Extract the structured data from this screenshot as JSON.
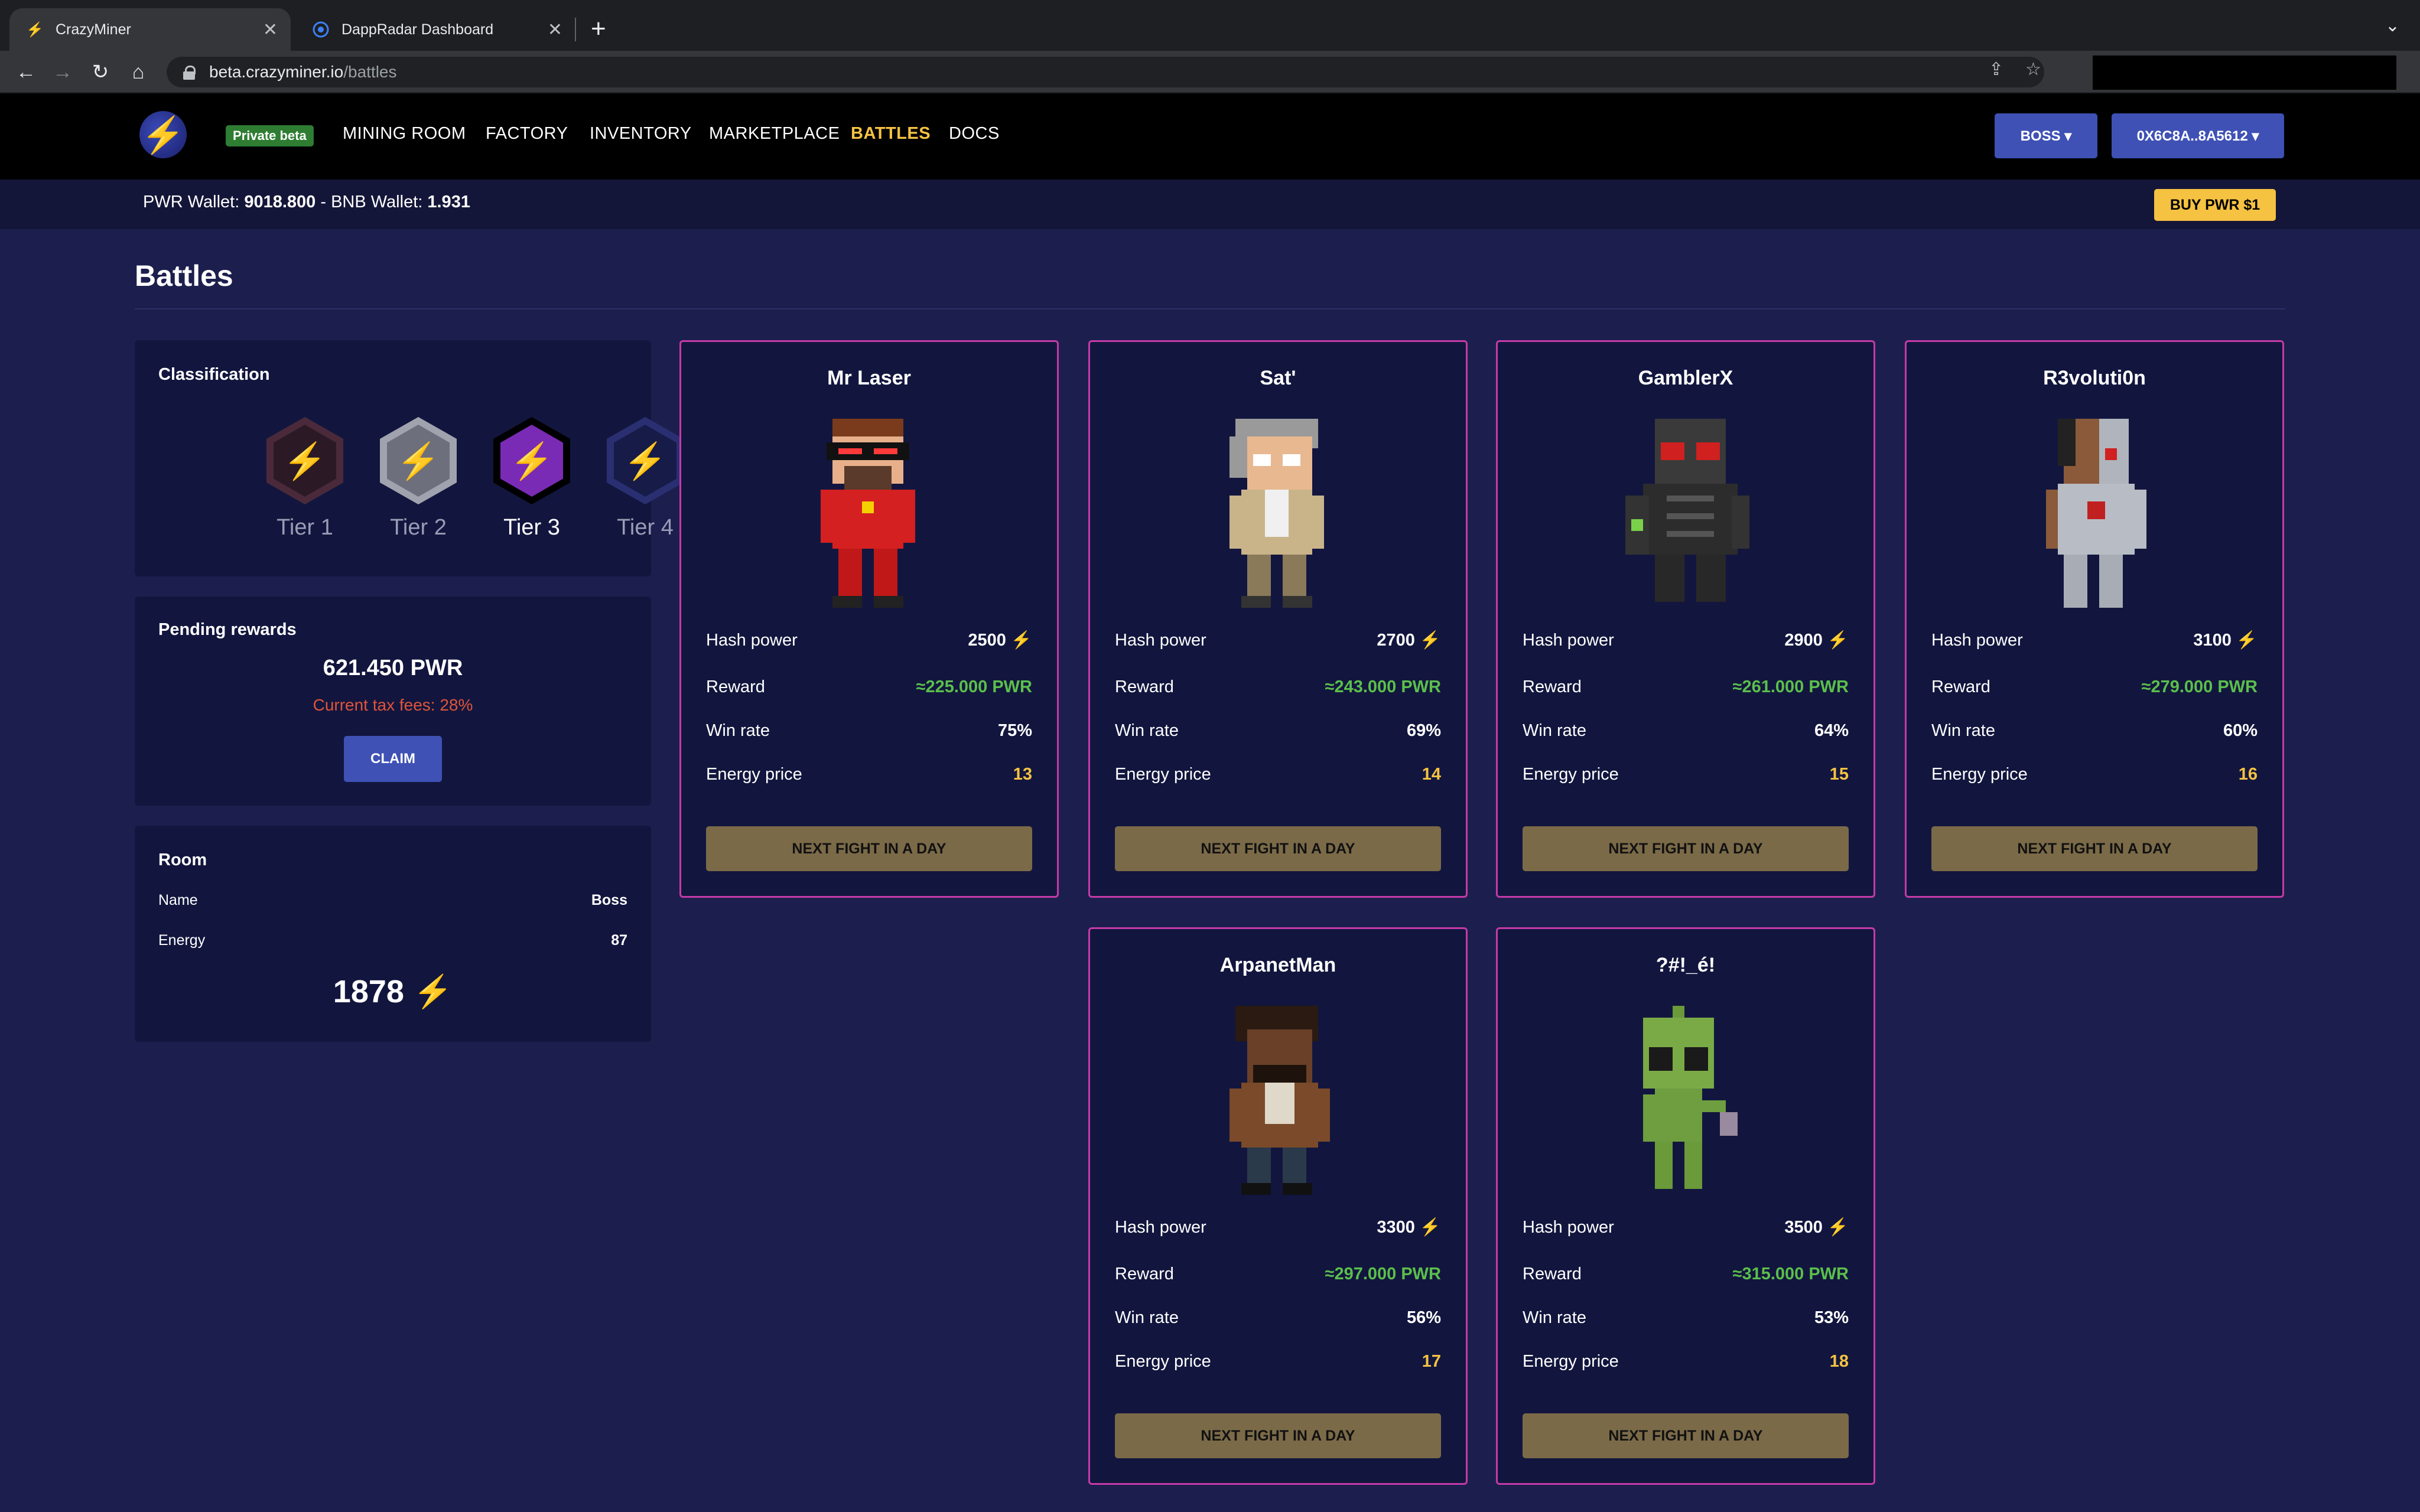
{
  "browser": {
    "tabs": [
      {
        "title": "CrazyMiner",
        "icon": "bolt-favicon"
      },
      {
        "title": "DappRadar Dashboard",
        "icon": "dappradar-favicon"
      }
    ],
    "url_host": "beta.crazyminer.io",
    "url_path": "/battles"
  },
  "header": {
    "badge": "Private beta",
    "nav": [
      "MINING ROOM",
      "FACTORY",
      "INVENTORY",
      "MARKETPLACE",
      "BATTLES",
      "DOCS"
    ],
    "active_nav": "BATTLES",
    "boss_button": "BOSS ▾",
    "wallet_button": "0X6C8A..8A5612 ▾"
  },
  "wallet_bar": {
    "pwr_label": "PWR Wallet: ",
    "pwr_value": "9018.800",
    "sep": " - BNB Wallet: ",
    "bnb_value": "1.931",
    "buy_button": "BUY PWR $1"
  },
  "page": {
    "title": "Battles"
  },
  "classification": {
    "title": "Classification",
    "tiers": [
      {
        "label": "Tier 1",
        "active": false,
        "color": "#3a1f2b"
      },
      {
        "label": "Tier 2",
        "active": false,
        "color": "#6d6f7d"
      },
      {
        "label": "Tier 3",
        "active": true,
        "color": "#7a2bb5"
      },
      {
        "label": "Tier 4",
        "active": false,
        "color": "#1d2156"
      }
    ]
  },
  "pending": {
    "title": "Pending rewards",
    "amount": "621.450 PWR",
    "tax": "Current tax fees: 28%",
    "claim_button": "CLAIM"
  },
  "room": {
    "title": "Room",
    "name_label": "Name",
    "name_value": "Boss",
    "energy_label": "Energy",
    "energy_value": "87",
    "total": "1878"
  },
  "stat_labels": {
    "hash": "Hash power",
    "reward": "Reward",
    "winrate": "Win rate",
    "energy": "Energy price"
  },
  "fight_label": "NEXT FIGHT IN A DAY",
  "fighters": [
    {
      "name": "Mr Laser",
      "hash": "2500",
      "reward": "≈225.000 PWR",
      "winrate": "75%",
      "energy": "13"
    },
    {
      "name": "Sat'",
      "hash": "2700",
      "reward": "≈243.000 PWR",
      "winrate": "69%",
      "energy": "14"
    },
    {
      "name": "GamblerX",
      "hash": "2900",
      "reward": "≈261.000 PWR",
      "winrate": "64%",
      "energy": "15"
    },
    {
      "name": "R3voluti0n",
      "hash": "3100",
      "reward": "≈279.000 PWR",
      "winrate": "60%",
      "energy": "16"
    },
    {
      "name": "ArpanetMan",
      "hash": "3300",
      "reward": "≈297.000 PWR",
      "winrate": "56%",
      "energy": "17"
    },
    {
      "name": "?#!_é!",
      "hash": "3500",
      "reward": "≈315.000 PWR",
      "winrate": "53%",
      "energy": "18"
    }
  ]
}
